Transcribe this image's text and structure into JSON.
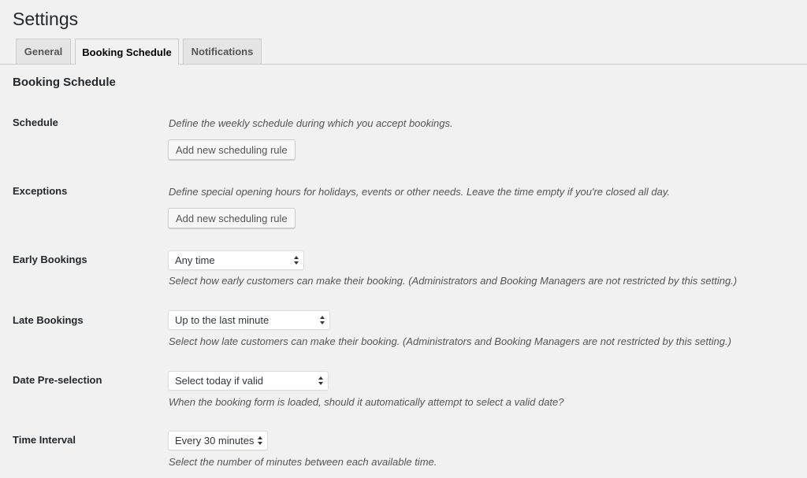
{
  "page": {
    "title": "Settings"
  },
  "tabs": [
    {
      "label": "General"
    },
    {
      "label": "Booking Schedule"
    },
    {
      "label": "Notifications"
    }
  ],
  "active_tab": "Booking Schedule",
  "section": {
    "title": "Booking Schedule"
  },
  "rows": {
    "schedule": {
      "label": "Schedule",
      "description": "Define the weekly schedule during which you accept bookings.",
      "button": "Add new scheduling rule"
    },
    "exceptions": {
      "label": "Exceptions",
      "description": "Define special opening hours for holidays, events or other needs. Leave the time empty if you're closed all day.",
      "button": "Add new scheduling rule"
    },
    "early_bookings": {
      "label": "Early Bookings",
      "value": "Any time",
      "description": "Select how early customers can make their booking. (Administrators and Booking Managers are not restricted by this setting.)"
    },
    "late_bookings": {
      "label": "Late Bookings",
      "value": "Up to the last minute",
      "description": "Select how late customers can make their booking. (Administrators and Booking Managers are not restricted by this setting.)"
    },
    "date_preselection": {
      "label": "Date Pre-selection",
      "value": "Select today if valid",
      "description": "When the booking form is loaded, should it automatically attempt to select a valid date?"
    },
    "time_interval": {
      "label": "Time Interval",
      "value": "Every 30 minutes",
      "description": "Select the number of minutes between each available time."
    }
  }
}
